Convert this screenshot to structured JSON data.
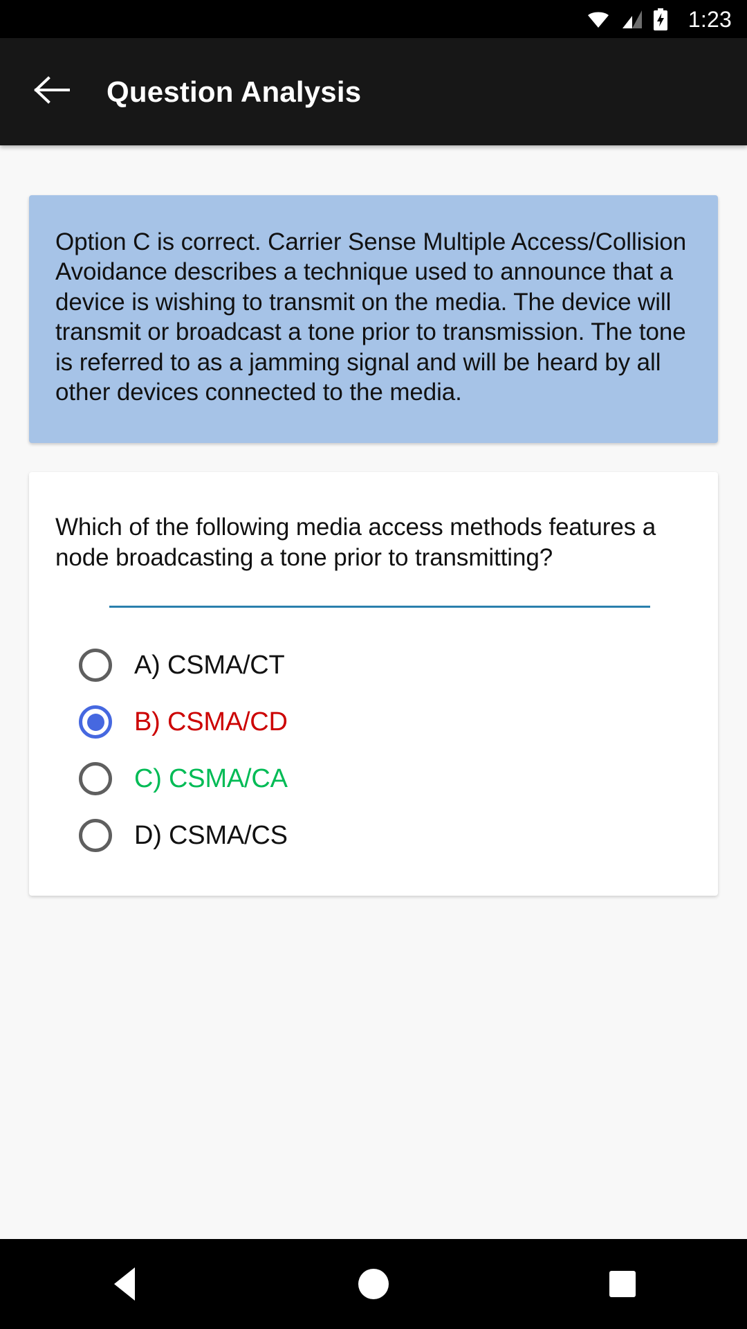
{
  "status_bar": {
    "time": "1:23",
    "icons": [
      "wifi-icon",
      "cell-signal-icon",
      "battery-charging-icon"
    ]
  },
  "toolbar": {
    "back_icon": "arrow-left-icon",
    "title": "Question Analysis"
  },
  "analysis": {
    "text": "Option C is correct. Carrier Sense Multiple Access/Collision Avoidance describes a technique used to announce that a device is wishing to transmit on the media. The device will transmit or broadcast a tone prior to transmission. The tone is referred to as a jamming signal and will be heard by all other devices connected to the media.",
    "background_color": "#a6c3e7"
  },
  "question": {
    "text": "Which of the following media access methods features a node broadcasting a tone prior to transmitting?",
    "divider_color": "#2a7fad",
    "options": [
      {
        "label": "A) CSMA/CT",
        "selected": false,
        "color": "#111111",
        "state": "neutral"
      },
      {
        "label": "B) CSMA/CD",
        "selected": true,
        "color": "#cc0000",
        "state": "chosen-incorrect"
      },
      {
        "label": "C) CSMA/CA",
        "selected": false,
        "color": "#00bb55",
        "state": "correct"
      },
      {
        "label": "D) CSMA/CS",
        "selected": false,
        "color": "#111111",
        "state": "neutral"
      }
    ],
    "selected_radio_color": "#4668e0",
    "unselected_radio_color": "#5f5f5f"
  },
  "nav_bar": {
    "buttons": [
      {
        "name": "nav-back-button",
        "icon": "triangle-back-icon"
      },
      {
        "name": "nav-home-button",
        "icon": "circle-home-icon"
      },
      {
        "name": "nav-recents-button",
        "icon": "square-recents-icon"
      }
    ]
  }
}
